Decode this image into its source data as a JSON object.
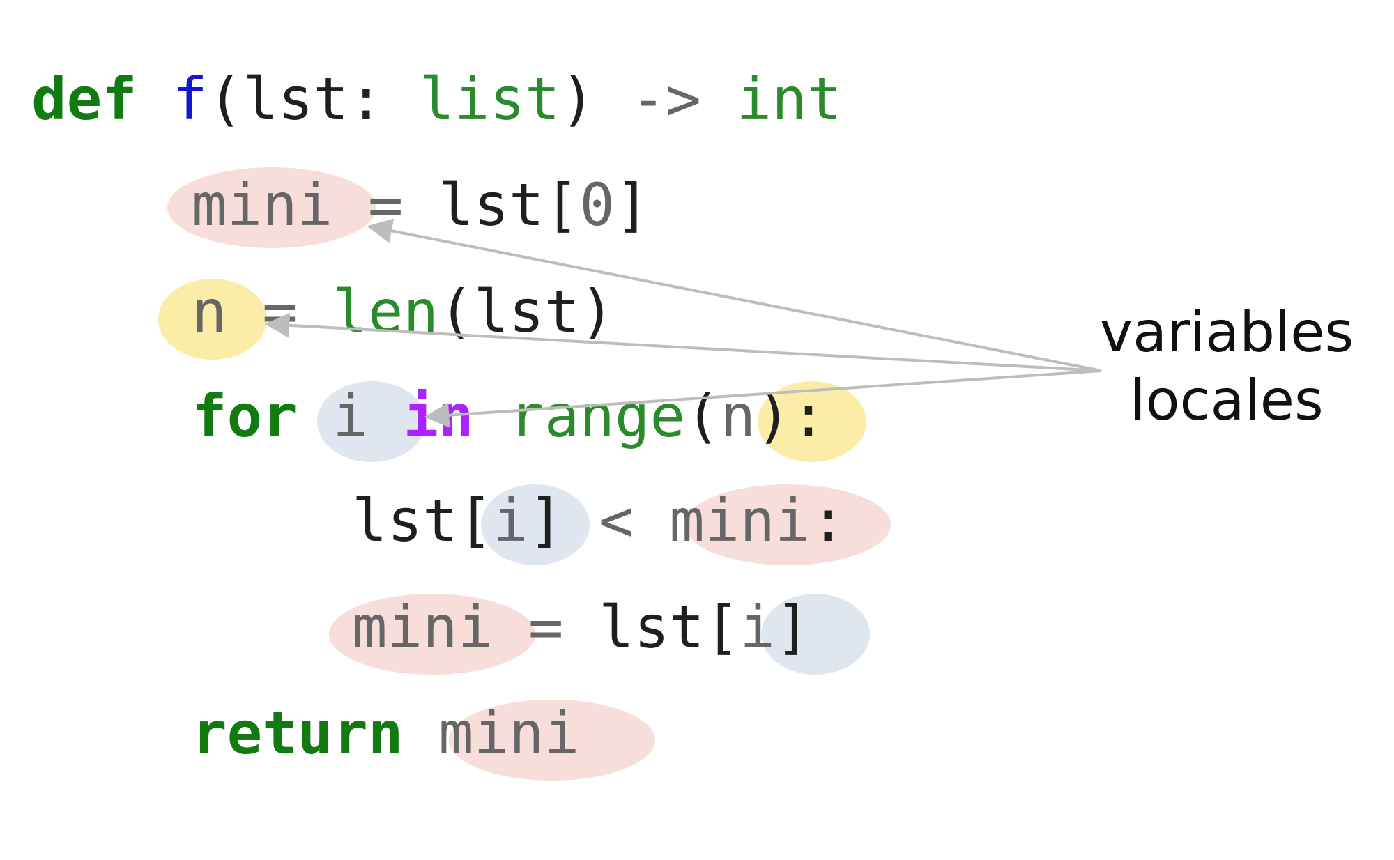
{
  "code": {
    "line1": {
      "kw_def": "def",
      "fname": "f",
      "open_paren": "(",
      "param": "lst",
      "colon": ":",
      "param_type": "list",
      "close_paren": ")",
      "arrow": "->",
      "ret_type": "int"
    },
    "line2": {
      "var_mini": "mini",
      "assign": "=",
      "rhs_lst": "lst",
      "open_bracket": "[",
      "index_zero": "0",
      "close_bracket": "]"
    },
    "line3": {
      "var_n": "n",
      "assign": "=",
      "func_len": "len",
      "open_paren": "(",
      "arg_lst": "lst",
      "close_paren": ")"
    },
    "line4": {
      "kw_for": "for",
      "var_i": "i",
      "kw_in": "in",
      "func_range": "range",
      "open_paren": "(",
      "arg_n": "n",
      "close_paren": ")",
      "colon": ":"
    },
    "line5": {
      "lst": "lst",
      "open_bracket": "[",
      "var_i": "i",
      "close_bracket": "]",
      "lt": "<",
      "var_mini": "mini",
      "colon": ":"
    },
    "line6": {
      "var_mini": "mini",
      "assign": "=",
      "lst": "lst",
      "open_bracket": "[",
      "var_i": "i",
      "close_bracket": "]"
    },
    "line7": {
      "kw_return": "return",
      "var_mini": "mini"
    }
  },
  "annotation": {
    "line1": "variables",
    "line2": "locales"
  },
  "colors": {
    "keyword": "#117a11",
    "keyword_in": "#aa22ff",
    "function_name": "#1515d0",
    "builtin": "#2b8a2b",
    "variable": "#666666",
    "highlight_mini": "#f8dedb",
    "highlight_n": "#fbeda8",
    "highlight_i": "#dfe6ef",
    "arrow": "#bdbdbd"
  }
}
